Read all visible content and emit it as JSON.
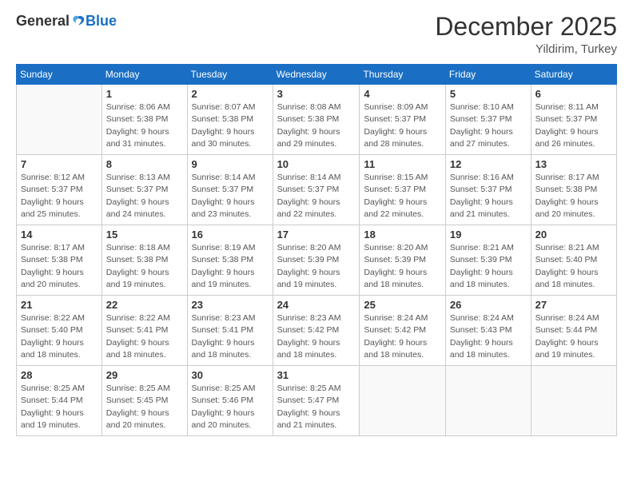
{
  "logo": {
    "general": "General",
    "blue": "Blue"
  },
  "header": {
    "month": "December 2025",
    "location": "Yildirim, Turkey"
  },
  "weekdays": [
    "Sunday",
    "Monday",
    "Tuesday",
    "Wednesday",
    "Thursday",
    "Friday",
    "Saturday"
  ],
  "weeks": [
    [
      {
        "day": "",
        "empty": true
      },
      {
        "day": "1",
        "sunrise": "Sunrise: 8:06 AM",
        "sunset": "Sunset: 5:38 PM",
        "daylight": "Daylight: 9 hours and 31 minutes."
      },
      {
        "day": "2",
        "sunrise": "Sunrise: 8:07 AM",
        "sunset": "Sunset: 5:38 PM",
        "daylight": "Daylight: 9 hours and 30 minutes."
      },
      {
        "day": "3",
        "sunrise": "Sunrise: 8:08 AM",
        "sunset": "Sunset: 5:38 PM",
        "daylight": "Daylight: 9 hours and 29 minutes."
      },
      {
        "day": "4",
        "sunrise": "Sunrise: 8:09 AM",
        "sunset": "Sunset: 5:37 PM",
        "daylight": "Daylight: 9 hours and 28 minutes."
      },
      {
        "day": "5",
        "sunrise": "Sunrise: 8:10 AM",
        "sunset": "Sunset: 5:37 PM",
        "daylight": "Daylight: 9 hours and 27 minutes."
      },
      {
        "day": "6",
        "sunrise": "Sunrise: 8:11 AM",
        "sunset": "Sunset: 5:37 PM",
        "daylight": "Daylight: 9 hours and 26 minutes."
      }
    ],
    [
      {
        "day": "7",
        "sunrise": "Sunrise: 8:12 AM",
        "sunset": "Sunset: 5:37 PM",
        "daylight": "Daylight: 9 hours and 25 minutes."
      },
      {
        "day": "8",
        "sunrise": "Sunrise: 8:13 AM",
        "sunset": "Sunset: 5:37 PM",
        "daylight": "Daylight: 9 hours and 24 minutes."
      },
      {
        "day": "9",
        "sunrise": "Sunrise: 8:14 AM",
        "sunset": "Sunset: 5:37 PM",
        "daylight": "Daylight: 9 hours and 23 minutes."
      },
      {
        "day": "10",
        "sunrise": "Sunrise: 8:14 AM",
        "sunset": "Sunset: 5:37 PM",
        "daylight": "Daylight: 9 hours and 22 minutes."
      },
      {
        "day": "11",
        "sunrise": "Sunrise: 8:15 AM",
        "sunset": "Sunset: 5:37 PM",
        "daylight": "Daylight: 9 hours and 22 minutes."
      },
      {
        "day": "12",
        "sunrise": "Sunrise: 8:16 AM",
        "sunset": "Sunset: 5:37 PM",
        "daylight": "Daylight: 9 hours and 21 minutes."
      },
      {
        "day": "13",
        "sunrise": "Sunrise: 8:17 AM",
        "sunset": "Sunset: 5:38 PM",
        "daylight": "Daylight: 9 hours and 20 minutes."
      }
    ],
    [
      {
        "day": "14",
        "sunrise": "Sunrise: 8:17 AM",
        "sunset": "Sunset: 5:38 PM",
        "daylight": "Daylight: 9 hours and 20 minutes."
      },
      {
        "day": "15",
        "sunrise": "Sunrise: 8:18 AM",
        "sunset": "Sunset: 5:38 PM",
        "daylight": "Daylight: 9 hours and 19 minutes."
      },
      {
        "day": "16",
        "sunrise": "Sunrise: 8:19 AM",
        "sunset": "Sunset: 5:38 PM",
        "daylight": "Daylight: 9 hours and 19 minutes."
      },
      {
        "day": "17",
        "sunrise": "Sunrise: 8:20 AM",
        "sunset": "Sunset: 5:39 PM",
        "daylight": "Daylight: 9 hours and 19 minutes."
      },
      {
        "day": "18",
        "sunrise": "Sunrise: 8:20 AM",
        "sunset": "Sunset: 5:39 PM",
        "daylight": "Daylight: 9 hours and 18 minutes."
      },
      {
        "day": "19",
        "sunrise": "Sunrise: 8:21 AM",
        "sunset": "Sunset: 5:39 PM",
        "daylight": "Daylight: 9 hours and 18 minutes."
      },
      {
        "day": "20",
        "sunrise": "Sunrise: 8:21 AM",
        "sunset": "Sunset: 5:40 PM",
        "daylight": "Daylight: 9 hours and 18 minutes."
      }
    ],
    [
      {
        "day": "21",
        "sunrise": "Sunrise: 8:22 AM",
        "sunset": "Sunset: 5:40 PM",
        "daylight": "Daylight: 9 hours and 18 minutes."
      },
      {
        "day": "22",
        "sunrise": "Sunrise: 8:22 AM",
        "sunset": "Sunset: 5:41 PM",
        "daylight": "Daylight: 9 hours and 18 minutes."
      },
      {
        "day": "23",
        "sunrise": "Sunrise: 8:23 AM",
        "sunset": "Sunset: 5:41 PM",
        "daylight": "Daylight: 9 hours and 18 minutes."
      },
      {
        "day": "24",
        "sunrise": "Sunrise: 8:23 AM",
        "sunset": "Sunset: 5:42 PM",
        "daylight": "Daylight: 9 hours and 18 minutes."
      },
      {
        "day": "25",
        "sunrise": "Sunrise: 8:24 AM",
        "sunset": "Sunset: 5:42 PM",
        "daylight": "Daylight: 9 hours and 18 minutes."
      },
      {
        "day": "26",
        "sunrise": "Sunrise: 8:24 AM",
        "sunset": "Sunset: 5:43 PM",
        "daylight": "Daylight: 9 hours and 18 minutes."
      },
      {
        "day": "27",
        "sunrise": "Sunrise: 8:24 AM",
        "sunset": "Sunset: 5:44 PM",
        "daylight": "Daylight: 9 hours and 19 minutes."
      }
    ],
    [
      {
        "day": "28",
        "sunrise": "Sunrise: 8:25 AM",
        "sunset": "Sunset: 5:44 PM",
        "daylight": "Daylight: 9 hours and 19 minutes."
      },
      {
        "day": "29",
        "sunrise": "Sunrise: 8:25 AM",
        "sunset": "Sunset: 5:45 PM",
        "daylight": "Daylight: 9 hours and 20 minutes."
      },
      {
        "day": "30",
        "sunrise": "Sunrise: 8:25 AM",
        "sunset": "Sunset: 5:46 PM",
        "daylight": "Daylight: 9 hours and 20 minutes."
      },
      {
        "day": "31",
        "sunrise": "Sunrise: 8:25 AM",
        "sunset": "Sunset: 5:47 PM",
        "daylight": "Daylight: 9 hours and 21 minutes."
      },
      {
        "day": "",
        "empty": true
      },
      {
        "day": "",
        "empty": true
      },
      {
        "day": "",
        "empty": true
      }
    ]
  ]
}
